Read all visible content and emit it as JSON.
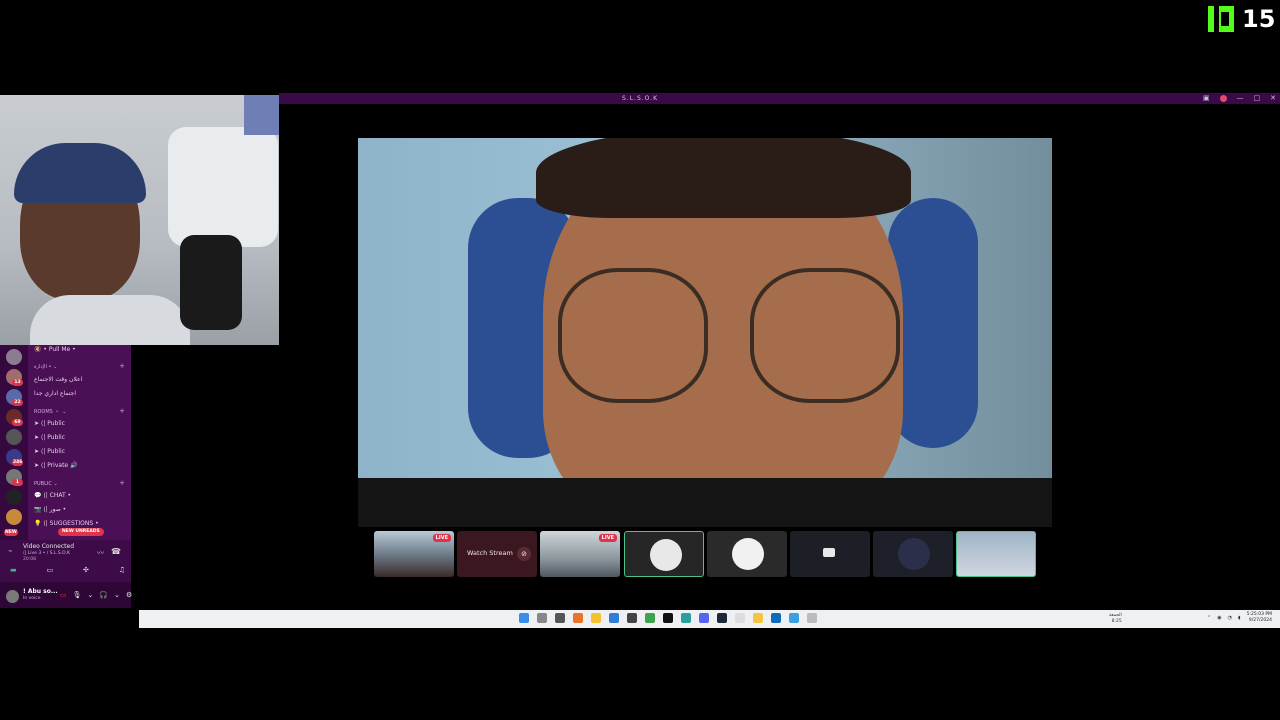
{
  "overlay": {
    "viewer_count": "15"
  },
  "window": {
    "title": "S.L.S.O.K"
  },
  "server": {
    "top_channel": "🔇 • Pull Me •",
    "categories": [
      {
        "label": "الإدارة • ⌄"
      },
      {
        "label": "ROOMS 🔹 ⌄"
      },
      {
        "label": "PUBLIC ⌄"
      }
    ],
    "channels": [
      {
        "label": "اعلان وقت الاجتماع"
      },
      {
        "label": "اجتماع اداري جدا"
      },
      {
        "label": "➤ ⟨| Public"
      },
      {
        "label": "➤ ⟨| Public"
      },
      {
        "label": "➤ ⟨| Public"
      },
      {
        "label": "➤ ⟨| Private 🔊"
      },
      {
        "label": "💬 ⟨| CHAT •"
      },
      {
        "label": "📷 ⟨| صور •"
      },
      {
        "label": "💡 ⟨| SUGGESTIONS •"
      }
    ],
    "guild_badges": [
      "13",
      "22",
      "69",
      "246",
      "1"
    ],
    "new_unreads": "NEW UNREADS",
    "new_label": "NEW"
  },
  "voice": {
    "status": "Video Connected",
    "channel": "⟨| Live 3 • / S.L.S.O.K",
    "time": "20:08"
  },
  "user": {
    "name": "! Abu so...",
    "status": "In voice"
  },
  "tiles": {
    "live_label": "LIVE",
    "watch_stream": "Watch Stream"
  },
  "taskbar": {
    "weather": "الجمعة",
    "weather_sub": "8:25",
    "clock_time": "5:25:03 PM",
    "clock_date": "9/27/2024"
  },
  "colors": {
    "discord_bg": "#4a0f55",
    "kick_green": "#53fc18",
    "live_red": "#e0334a"
  }
}
